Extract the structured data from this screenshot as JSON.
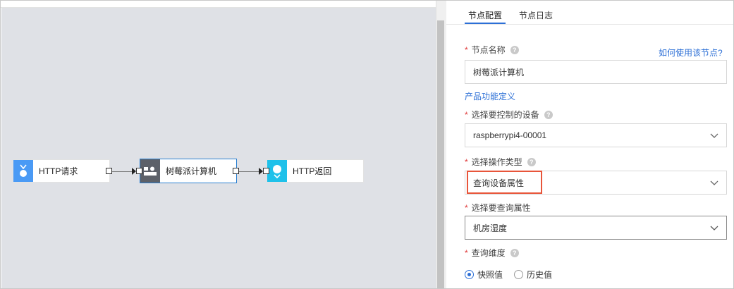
{
  "flow": {
    "nodes": [
      {
        "label": "HTTP请求",
        "icon": "http-request-icon",
        "color": "#4a9af5"
      },
      {
        "label": "树莓派计算机",
        "icon": "device-icon",
        "color": "#5d6169"
      },
      {
        "label": "HTTP返回",
        "icon": "http-response-icon",
        "color": "#1fc1ea"
      }
    ]
  },
  "panel": {
    "tabs": [
      {
        "label": "节点配置",
        "active": true
      },
      {
        "label": "节点日志",
        "active": false
      }
    ],
    "node_name": {
      "label": "节点名称",
      "value": "树莓派计算机",
      "help_link": "如何使用该节点?"
    },
    "product_link": "产品功能定义",
    "device": {
      "label": "选择要控制的设备",
      "value": "raspberrypi4-00001"
    },
    "operation": {
      "label": "选择操作类型",
      "value": "查询设备属性"
    },
    "property": {
      "label": "选择要查询属性",
      "value": "机房湿度"
    },
    "dimension": {
      "label": "查询维度",
      "options": [
        {
          "label": "快照值",
          "selected": true
        },
        {
          "label": "历史值",
          "selected": false
        }
      ]
    },
    "help_glyph": "?",
    "required_mark": "*"
  },
  "colors": {
    "accent": "#2c6fd6",
    "highlight": "#e8553a",
    "canvas": "#dfe1e6"
  }
}
